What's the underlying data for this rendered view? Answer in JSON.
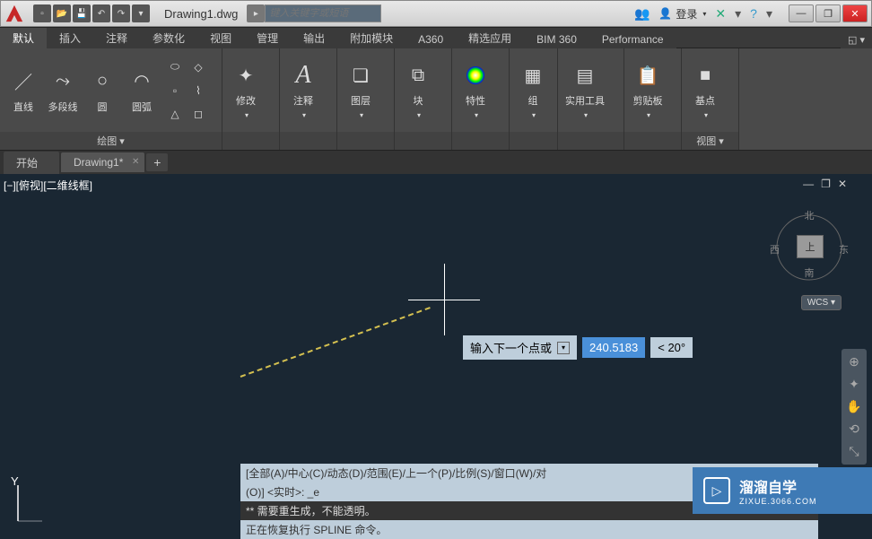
{
  "title": "Drawing1.dwg",
  "search_placeholder": "键入关键字或短语",
  "login": {
    "label": "登录",
    "people_icon": "people-icon"
  },
  "win": {
    "min": "—",
    "max": "❐",
    "close": "✕"
  },
  "qat": [
    "new",
    "open",
    "save",
    "undo",
    "redo",
    "plot"
  ],
  "ribbon_tabs": [
    "默认",
    "插入",
    "注释",
    "参数化",
    "视图",
    "管理",
    "输出",
    "附加模块",
    "A360",
    "精选应用",
    "BIM 360",
    "Performance"
  ],
  "ribbon_tabs_active": 0,
  "panels": {
    "draw": {
      "title": "绘图 ▾",
      "items": [
        {
          "label": "直线",
          "icon": "／"
        },
        {
          "label": "多段线",
          "icon": "⤳"
        },
        {
          "label": "圆",
          "icon": "○"
        },
        {
          "label": "圆弧",
          "icon": "◠"
        }
      ],
      "smalls": [
        "⬭",
        "◇",
        "▫",
        "⌇",
        "△",
        "◻"
      ]
    },
    "modify": {
      "title": "",
      "label": "修改",
      "icon": "✦"
    },
    "annotate": {
      "title": "",
      "label": "注释",
      "icon": "A"
    },
    "layer": {
      "title": "",
      "label": "图层",
      "icon": "❏"
    },
    "block": {
      "title": "",
      "label": "块",
      "icon": "⧉"
    },
    "properties": {
      "title": "",
      "label": "特性",
      "icon": "●"
    },
    "group": {
      "title": "",
      "label": "组",
      "icon": "▦"
    },
    "utilities": {
      "title": "",
      "label": "实用工具",
      "icon": "▤"
    },
    "clipboard": {
      "title": "",
      "label": "剪贴板",
      "icon": "📋"
    },
    "view": {
      "title": "视图 ▾",
      "label": "基点",
      "icon": "■"
    }
  },
  "file_tabs": [
    {
      "label": "开始",
      "active": false,
      "closeable": false
    },
    {
      "label": "Drawing1*",
      "active": true,
      "closeable": true
    }
  ],
  "viewport": {
    "label": "[−][俯视][二维线框]",
    "controls": [
      "—",
      "❐",
      "✕"
    ],
    "dyn_prompt": "输入下一个点或",
    "dyn_value": "240.5183",
    "dyn_angle": "<  20°",
    "ucs_y": "Y"
  },
  "viewcube": {
    "n": "北",
    "s": "南",
    "e": "东",
    "w": "西",
    "top": "上",
    "wcs": "WCS ▾"
  },
  "nav_items": [
    "⊕",
    "✦",
    "✋",
    "⟲",
    "⤡"
  ],
  "cmd": [
    "[全部(A)/中心(C)/动态(D)/范围(E)/上一个(P)/比例(S)/窗口(W)/对",
    "(O)] <实时>: _e",
    "** 需要重生成，不能透明。",
    "正在恢复执行 SPLINE 命令。"
  ],
  "watermark": {
    "title": "溜溜自学",
    "sub": "ZIXUE.3066.COM",
    "icon": "▷"
  }
}
